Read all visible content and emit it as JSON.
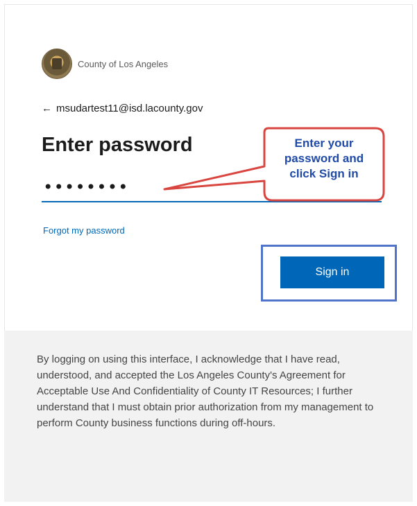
{
  "branding": {
    "org_name": "County of Los Angeles",
    "logo_icon": "county-seal-icon"
  },
  "account": {
    "back_icon": "←",
    "email": "msudartest11@isd.lacounty.gov"
  },
  "form": {
    "title": "Enter password",
    "password_value": "••••••••",
    "forgot_label": "Forgot my password",
    "signin_label": "Sign in"
  },
  "callout": {
    "lines": [
      "Enter your",
      "password and",
      "click Sign in"
    ],
    "border_color": "#d9463f",
    "text_color": "#1f4aa8"
  },
  "colors": {
    "accent": "#0067b8",
    "highlight_border": "#4f74c9",
    "footer_bg": "#f2f2f2"
  },
  "footer": {
    "text": "By logging on using this interface, I acknowledge that I have read, understood, and accepted the Los Angeles County's Agreement for Acceptable Use And Confidentiality of County IT Resources; I further understand that I must obtain prior authorization from my management to perform County business functions during off-hours."
  }
}
